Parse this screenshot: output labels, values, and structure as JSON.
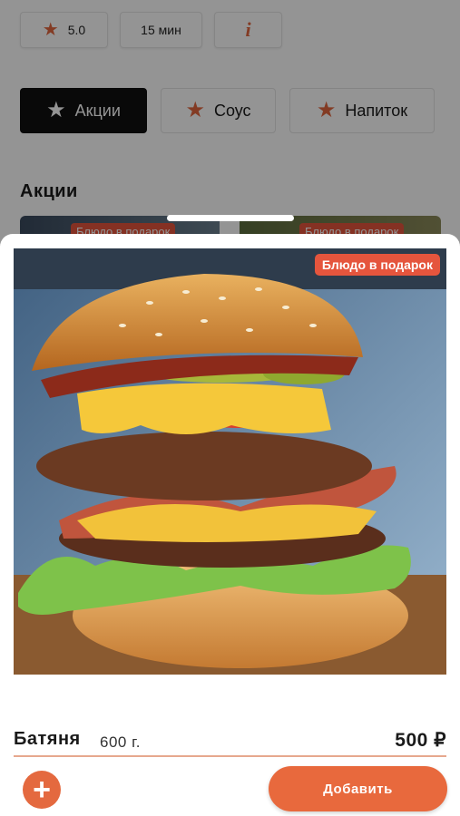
{
  "info_bar": {
    "rating": "5.0",
    "time": "15 мин",
    "info_glyph": "i"
  },
  "categories": [
    {
      "label": "Акции",
      "active": true,
      "icon": "star-icon"
    },
    {
      "label": "Соус",
      "active": false,
      "icon": "star-icon"
    },
    {
      "label": "Напиток",
      "active": false,
      "icon": "star-icon"
    }
  ],
  "section": {
    "title": "Акции",
    "peek_badge": "Блюдо в подарок"
  },
  "product": {
    "badge": "Блюдо в подарок",
    "image": "burger-photo",
    "name": "Батяня",
    "weight": "600 г.",
    "price": "500 ₽",
    "add_label": "Добавить",
    "plus_glyph": "+"
  },
  "colors": {
    "accent": "#e8693d",
    "badge": "#e5553d",
    "active_category": "#111111"
  }
}
